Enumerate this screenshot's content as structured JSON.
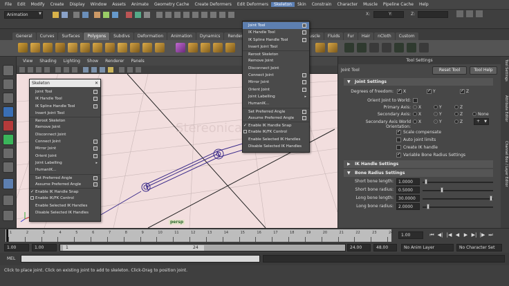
{
  "menubar": [
    "File",
    "Edit",
    "Modify",
    "Create",
    "Display",
    "Window",
    "Assets",
    "Animate",
    "Geometry Cache",
    "Create Deformers",
    "Edit Deformers",
    "Skeleton",
    "Skin",
    "Constrain",
    "Character",
    "Muscle",
    "Pipeline Cache",
    "Help"
  ],
  "menubar_active": "Skeleton",
  "status_line": {
    "mode": "Animation",
    "x_label": "X:",
    "y_label": "Y:",
    "z_label": "Z:"
  },
  "shelf_tabs": [
    "General",
    "Curves",
    "Surfaces",
    "Polygons",
    "Subdivs",
    "Deformation",
    "Animation",
    "Dynamics",
    "Rendering",
    "PaintEffects",
    "Toon",
    "Muscle",
    "Fluids",
    "Fur",
    "Hair",
    "nCloth",
    "Custom"
  ],
  "shelf_active": "Polygons",
  "panel_menu": [
    "View",
    "Shading",
    "Lighting",
    "Show",
    "Renderer",
    "Panels"
  ],
  "camera_label": "persp",
  "watermark": "Stereonicas.com",
  "skeleton_menu": {
    "title": "Skeleton",
    "items": [
      {
        "label": "Joint Tool",
        "option": true
      },
      {
        "label": "IK Handle Tool",
        "option": true
      },
      {
        "label": "IK Spline Handle Tool",
        "option": true
      },
      {
        "label": "Insert Joint Tool"
      },
      {
        "label": "Reroot Skeleton",
        "sep": true
      },
      {
        "label": "Remove Joint"
      },
      {
        "label": "Disconnect Joint"
      },
      {
        "label": "Connect Joint",
        "option": true
      },
      {
        "label": "Mirror Joint",
        "option": true
      },
      {
        "label": "Orient Joint",
        "option": true
      },
      {
        "label": "Joint Labelling",
        "submenu": true
      },
      {
        "label": "HumanIK..."
      },
      {
        "label": "Set Preferred Angle",
        "option": true,
        "sep": true
      },
      {
        "label": "Assume Preferred Angle",
        "option": true
      },
      {
        "label": "Enable IK Handle Snap",
        "checked": true,
        "sep": true
      },
      {
        "label": "Enable IK/FK Control",
        "checkbox": true
      },
      {
        "label": "Enable Selected IK Handles"
      },
      {
        "label": "Disable Selected IK Handles"
      }
    ]
  },
  "tool_settings": {
    "header": "Tool Settings",
    "tool_name": "Joint Tool",
    "reset_button": "Reset Tool",
    "help_button": "Tool Help",
    "joint_settings": {
      "title": "Joint Settings",
      "dof_label": "Degrees of freedom:",
      "dof": [
        "X",
        "Y",
        "Z"
      ],
      "orient_world_label": "Orient Joint to World:",
      "primary_axis_label": "Primary Axis:",
      "primary_axis": [
        "X",
        "Y",
        "Z"
      ],
      "primary_axis_selected": "X",
      "secondary_axis_label": "Secondary Axis:",
      "secondary_axis": [
        "X",
        "Y",
        "Z",
        "None"
      ],
      "secondary_axis_selected": "Y",
      "sec_world_label": "Secondary Axis World Orientation:",
      "sec_world_value": "+",
      "sec_world_axes": [
        "X",
        "Y",
        "Z"
      ],
      "sec_world_selected": "Y",
      "options": [
        {
          "label": "Scale compensate",
          "checked": true
        },
        {
          "label": "Auto joint limits",
          "checked": false
        },
        {
          "label": "Create IK handle",
          "checked": false
        },
        {
          "label": "Variable Bone Radius Settings",
          "checked": true
        }
      ]
    },
    "ik_handle_settings": {
      "title": "IK Handle Settings"
    },
    "bone_radius": {
      "title": "Bone Radius Settings",
      "fields": [
        {
          "label": "Short bone length:",
          "value": "1.0000"
        },
        {
          "label": "Short bone radius:",
          "value": "0.5000"
        },
        {
          "label": "Long bone length:",
          "value": "30.0000"
        },
        {
          "label": "Long bone radius:",
          "value": "2.0000"
        }
      ]
    }
  },
  "side_tabs": [
    "Tool Settings",
    "Attribute Editor",
    "Channel Box / Layer Editor"
  ],
  "time_ticks": [
    "1",
    "2",
    "3",
    "4",
    "5",
    "6",
    "7",
    "8",
    "9",
    "10",
    "11",
    "12",
    "13",
    "14",
    "15",
    "16",
    "17",
    "18",
    "19",
    "20",
    "21",
    "22",
    "23",
    "24"
  ],
  "current_frame": "1.00",
  "range": {
    "start": "1.00",
    "playback_start": "1.00",
    "slider_start": "1",
    "slider_end": "24",
    "playback_end": "24.00",
    "end": "48.00",
    "anim_layer": "No Anim Layer",
    "character": "No Character Set"
  },
  "mel_label": "MEL",
  "help_line": "Click to place joint. Click on existing joint to add to skeleton. Click-Drag to position joint."
}
